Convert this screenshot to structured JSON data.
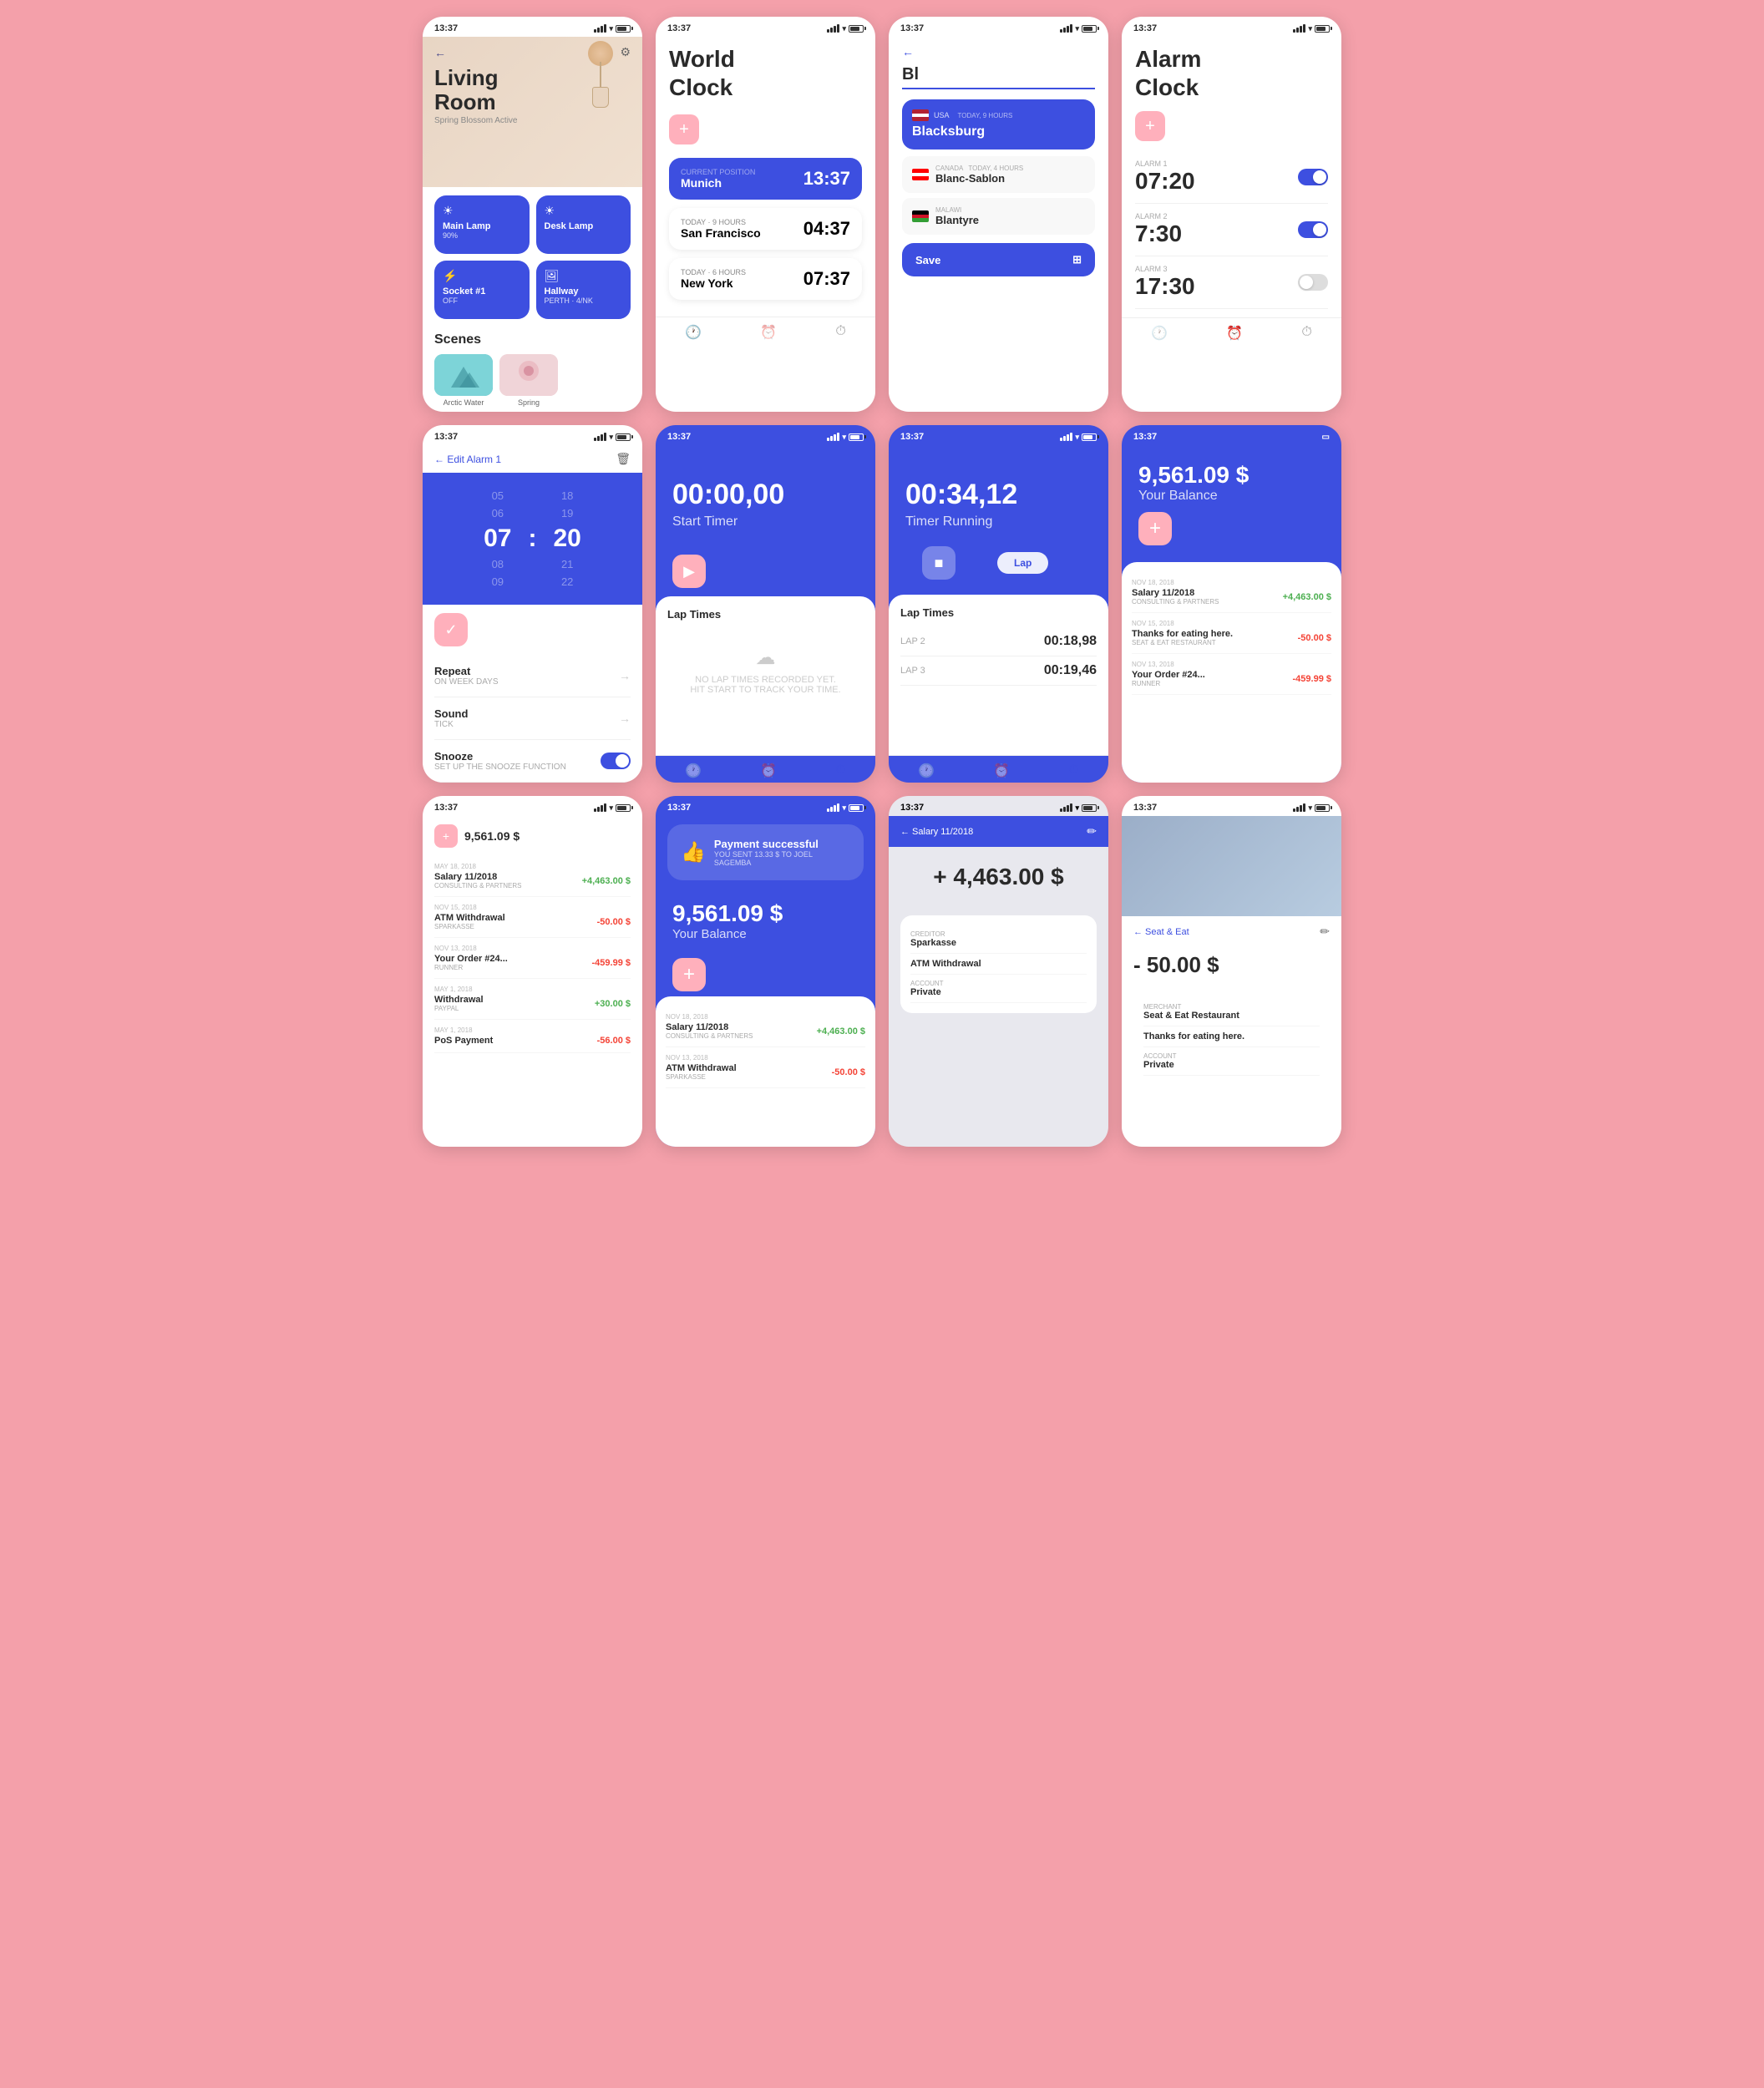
{
  "row1": {
    "phone1": {
      "time": "13:37",
      "roomTitle": "Living\nRoom",
      "subtitle": "Spring Blossom Active",
      "devices": [
        {
          "name": "Main Lamp",
          "status": "90%",
          "icon": "☀"
        },
        {
          "name": "Desk Lamp",
          "status": "",
          "icon": "☀"
        },
        {
          "name": "Socket #1",
          "status": "OFF",
          "icon": "⚡"
        },
        {
          "name": "Hallway",
          "status": "PERTH · 4/NK",
          "icon": "🖼"
        }
      ],
      "scenesTitle": "Scenes",
      "scene1": "Arctic Water",
      "scene2": "Spring"
    },
    "phone2": {
      "time": "13:37",
      "title": "World\nClock",
      "addBtnLabel": "+",
      "currentLabel": "CURRENT POSITION",
      "currentCity": "Munich",
      "currentTime": "13:37",
      "clocks": [
        {
          "label": "TODAY · 9 HOURS",
          "city": "San Francisco",
          "time": "04:37"
        },
        {
          "label": "TODAY · 6 HOURS",
          "city": "New York",
          "time": "07:37"
        }
      ]
    },
    "phone3": {
      "time": "13:37",
      "searchValue": "Bl",
      "results": [
        {
          "country": "USA",
          "detail": "TODAY, 9 HOURS",
          "city": "Blacksburg",
          "active": true
        },
        {
          "country": "CANADA",
          "detail": "TODAY, 4 HOURS",
          "city": "Blanc-Sablon",
          "active": false
        },
        {
          "country": "MALAWI",
          "detail": "",
          "city": "Blantyre",
          "active": false
        }
      ],
      "saveLabel": "Save"
    },
    "phone4": {
      "time": "13:37",
      "title": "Alarm\nClock",
      "addBtnLabel": "+",
      "alarms": [
        {
          "label": "ALARM 1",
          "time": "07:20",
          "on": true
        },
        {
          "label": "ALARM 2",
          "time": "7:30",
          "on": true
        },
        {
          "label": "ALARM 3",
          "time": "17:30",
          "on": false
        }
      ]
    }
  },
  "row2": {
    "phone5": {
      "time": "13:37",
      "title": "Edit Alarm 1",
      "hours": [
        "05",
        "06",
        "07",
        "08",
        "09"
      ],
      "minutes": [
        "18",
        "19",
        "20",
        "21",
        "22"
      ],
      "activeHour": "07",
      "activeMinute": "20",
      "checkmark": "✓",
      "settings": [
        {
          "label": "Repeat",
          "value": "ON WEEK DAYS"
        },
        {
          "label": "Sound",
          "value": "TICK"
        },
        {
          "label": "Snooze",
          "value": "SET UP THE SNOOZE FUNCTION",
          "type": "toggle"
        }
      ]
    },
    "phone6": {
      "time": "13:37",
      "timerDisplay": "00:00,00",
      "timerLabel": "Start Timer",
      "playBtn": "▶",
      "lapTimesTitle": "Lap Times",
      "lapEmptyMsg": "NO LAP TIMES RECORDED YET.\nHIT START TO TRACK YOUR TIME."
    },
    "phone7": {
      "time": "13:37",
      "timerDisplay": "00:34,12",
      "timerLabel": "Timer Running",
      "stopBtn": "■",
      "lapBtn": "Lap",
      "lapTimesTitle": "Lap Times",
      "laps": [
        {
          "label": "LAP 2",
          "time": "00:18,98"
        },
        {
          "label": "LAP 3",
          "time": "00:19,46"
        }
      ]
    },
    "phone8": {
      "time": "13:37",
      "balance": "9,561.09 $",
      "balanceLabel": "Your Balance",
      "addBtn": "+",
      "transactions": [
        {
          "date": "NOV 18, 2018",
          "name": "Salary 11/2018",
          "sub": "CONSULTING & PARTNERS",
          "amount": "+4,463.00 $",
          "pos": true
        },
        {
          "date": "NOV 15, 2018",
          "name": "Thanks for eating here.",
          "sub": "SEAT & EAT RESTAURANT",
          "amount": "-50.00 $",
          "pos": false
        },
        {
          "date": "NOV 13, 2018",
          "name": "Your Order #24...",
          "sub": "RUNNER",
          "amount": "-459.99 $",
          "pos": false
        }
      ]
    }
  },
  "row3": {
    "phone9": {
      "time": "13:37",
      "balanceAmount": "9,561.09 $",
      "transactions": [
        {
          "date": "MAY 18, 2018",
          "name": "Salary 11/2018",
          "sub": "CONSULTING & PARTNERS",
          "amount": "+4,463.00 $",
          "pos": true
        },
        {
          "date": "NOV 15, 2018",
          "name": "ATM Withdrawal",
          "sub": "SPARKASSE",
          "amount": "-50.00 $",
          "pos": false
        },
        {
          "date": "NOV 13, 2018",
          "name": "Your Order #24...",
          "sub": "RUNNER",
          "amount": "-459.99 $",
          "pos": false
        },
        {
          "date": "MAY 1, 2018",
          "name": "Withdrawal",
          "sub": "PAYPAL",
          "amount": "+30.00 $",
          "pos": true
        },
        {
          "date": "MAY 1, 2018",
          "name": "PoS Payment",
          "sub": "",
          "amount": "-56.00 $",
          "pos": false
        }
      ]
    },
    "phone10": {
      "time": "13:37",
      "successTitle": "Payment successful",
      "successSub": "YOU SENT 13.33 $ TO JOEL SAGEMBA",
      "balance": "9,561.09 $",
      "balanceLabel": "Your Balance",
      "transactions": [
        {
          "date": "NOV 18, 2018",
          "name": "Salary 11/2018",
          "sub": "CONSULTING & PARTNERS",
          "amount": "+4,463.00 $",
          "pos": true
        },
        {
          "date": "NOV 13, 2018",
          "name": "ATM Withdrawal",
          "sub": "SPARKASSE",
          "amount": "-50.00 $",
          "pos": false
        }
      ]
    },
    "phone11": {
      "time": "13:37",
      "headerTitle": "Salary 11/2018",
      "amount": "+ 4,463.00 $",
      "details": [
        {
          "label": "CREDITOR",
          "value": "Sparkasse"
        },
        {
          "label": "",
          "value": "ATM Withdrawal"
        },
        {
          "label": "ACCOUNT",
          "value": "Private"
        }
      ]
    },
    "phone12": {
      "time": "13:37",
      "headerTitle": "Seat & Eat",
      "amount": "- 50.00 $",
      "details": [
        {
          "label": "MERCHANT",
          "value": "Seat & Eat Restaurant"
        },
        {
          "label": "",
          "value": "Thanks for eating here."
        },
        {
          "label": "ACCOUNT",
          "value": "Private"
        }
      ]
    }
  }
}
